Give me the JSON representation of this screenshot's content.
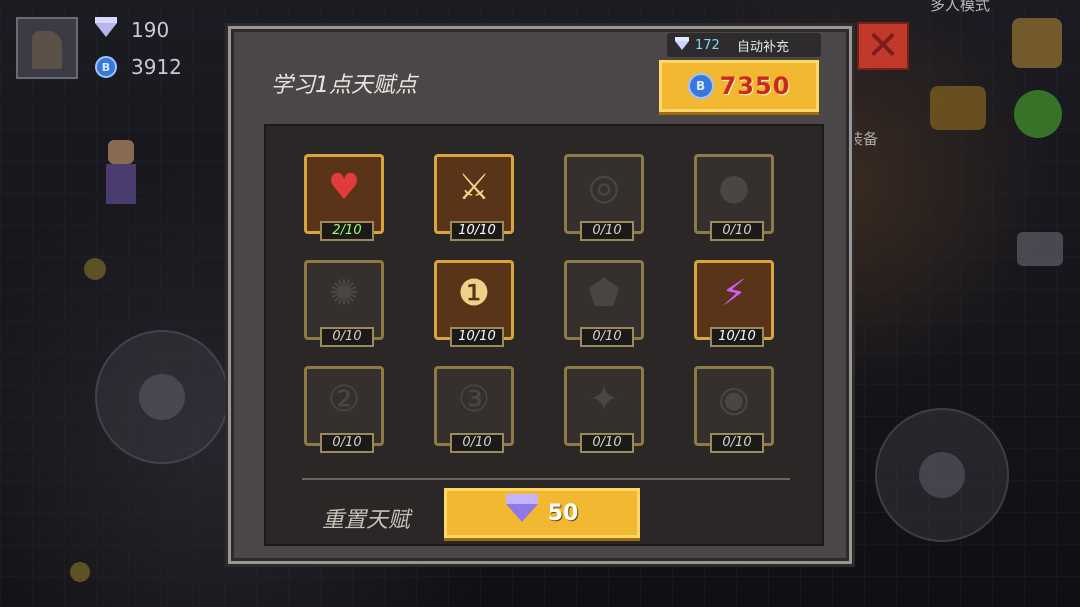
{
  "hud": {
    "gems": "190",
    "coins": "3912",
    "multiplayer_label": "多人模式",
    "equipment_label": "装备"
  },
  "dialog": {
    "title": "学习1点天赋点",
    "auto_refill_count": "172",
    "auto_refill_label": "自动补充",
    "coin_cost": "7350",
    "reset_label": "重置天赋",
    "reset_cost": "50"
  },
  "talents": [
    {
      "icon": "heart-icon",
      "level": "2/10",
      "active": true
    },
    {
      "icon": "sword-icon",
      "level": "10/10",
      "active": true
    },
    {
      "icon": "swirl-icon",
      "level": "0/10",
      "active": false
    },
    {
      "icon": "drop-icon",
      "level": "0/10",
      "active": false
    },
    {
      "icon": "orb-icon",
      "level": "0/10",
      "active": false
    },
    {
      "icon": "medal-icon",
      "level": "10/10",
      "active": true
    },
    {
      "icon": "shield-icon",
      "level": "0/10",
      "active": false
    },
    {
      "icon": "lightning-icon",
      "level": "10/10",
      "active": true
    },
    {
      "icon": "number-two-icon",
      "level": "0/10",
      "active": false
    },
    {
      "icon": "number-three-icon",
      "level": "0/10",
      "active": false
    },
    {
      "icon": "sparkle-icon",
      "level": "0/10",
      "active": false
    },
    {
      "icon": "eye-icon",
      "level": "0/10",
      "active": false
    }
  ],
  "colors": {
    "accent_gold": "#f3b832",
    "price_red": "#c92a1e",
    "panel": "#4b4748"
  }
}
